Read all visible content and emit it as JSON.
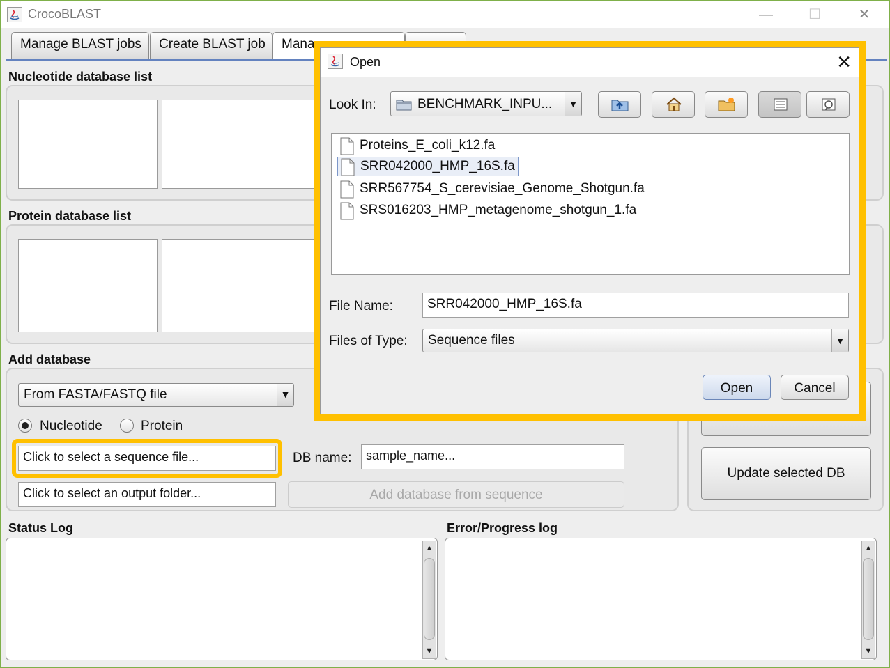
{
  "window": {
    "title": "CrocoBLAST",
    "minimize": "—",
    "maximize": "☐",
    "close": "✕"
  },
  "tabs": [
    {
      "label": "Manage BLAST jobs"
    },
    {
      "label": "Create BLAST job"
    },
    {
      "label": "Mana"
    },
    {
      "label": ""
    }
  ],
  "nucleotide_panel": {
    "title": "Nucleotide database list"
  },
  "protein_panel": {
    "title": "Protein database list"
  },
  "add_database": {
    "title": "Add database",
    "source_selected": "From FASTA/FASTQ file",
    "dropdown_arrow": "▼",
    "radio_nucleotide": "Nucleotide",
    "radio_protein": "Protein",
    "selected_type": "Nucleotide",
    "sequence_file_field": "Click to select a sequence file...",
    "db_name_label": "DB name:",
    "db_name_value": "sample_name...",
    "output_folder_field": "Click to select an output folder...",
    "add_button": "Add database from sequence"
  },
  "right_buttons": {
    "update_db": "Update selected DB"
  },
  "status_log": {
    "title": "Status Log",
    "up": "▲",
    "down": "▼"
  },
  "error_log": {
    "title": "Error/Progress log",
    "up": "▲",
    "down": "▼"
  },
  "dialog": {
    "title": "Open",
    "close": "✕",
    "look_in_label": "Look In:",
    "look_in_value": "BENCHMARK_INPU...",
    "combo_arrow": "▼",
    "files": [
      {
        "name": "Proteins_E_coli_k12.fa"
      },
      {
        "name": "SRR042000_HMP_16S.fa"
      },
      {
        "name": "SRR567754_S_cerevisiae_Genome_Shotgun.fa"
      },
      {
        "name": "SRS016203_HMP_metagenome_shotgun_1.fa"
      }
    ],
    "selected_file": "SRR042000_HMP_16S.fa",
    "file_name_label": "File Name:",
    "file_name_value": "SRR042000_HMP_16S.fa",
    "files_of_type_label": "Files of Type:",
    "files_of_type_value": "Sequence files",
    "open_button": "Open",
    "cancel_button": "Cancel"
  },
  "colors": {
    "highlight": "#ffc000",
    "tab_line": "#6382bf",
    "frame": "#7fb04a"
  }
}
